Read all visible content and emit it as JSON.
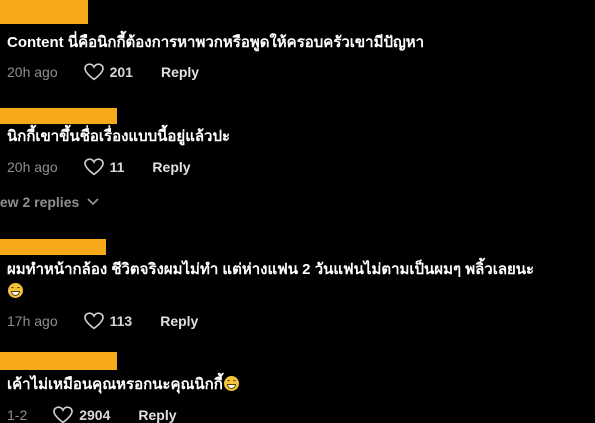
{
  "colors": {
    "background": "#000000",
    "redaction": "#f7a81b",
    "meta_text": "#8f8f8f"
  },
  "comments": [
    {
      "text": "Content นี่คือนิกกี้ต้องการหาพวกหรือพูดให้ครอบครัวเขามีปัญหา",
      "time": "20h ago",
      "likes": "201",
      "reply_label": "Reply",
      "emoji": ""
    },
    {
      "text": "นิกกี้เขาขึ้นชื่อเรื่องแบบนี้อยู่แล้วปะ",
      "time": "20h ago",
      "likes": "11",
      "reply_label": "Reply",
      "emoji": ""
    },
    {
      "text": "ผมทำหน้ากล้อง ชีวิตจริงผมไม่ทำ แต่ห่างแฟน 2 วันแฟนไม่ตามเป็นผมๆ พลิ้วเลยนะ",
      "time": "17h ago",
      "likes": "113",
      "reply_label": "Reply",
      "emoji": "grinning-face"
    },
    {
      "text": "เค้าไม่เหมือนคุณหรอกนะคุณนิกกี้",
      "time": "1-2",
      "likes": "2904",
      "reply_label": "Reply",
      "emoji": "grinning-face"
    }
  ],
  "view_replies": {
    "label": "iew 2 replies",
    "icon": "chevron-down-icon"
  }
}
